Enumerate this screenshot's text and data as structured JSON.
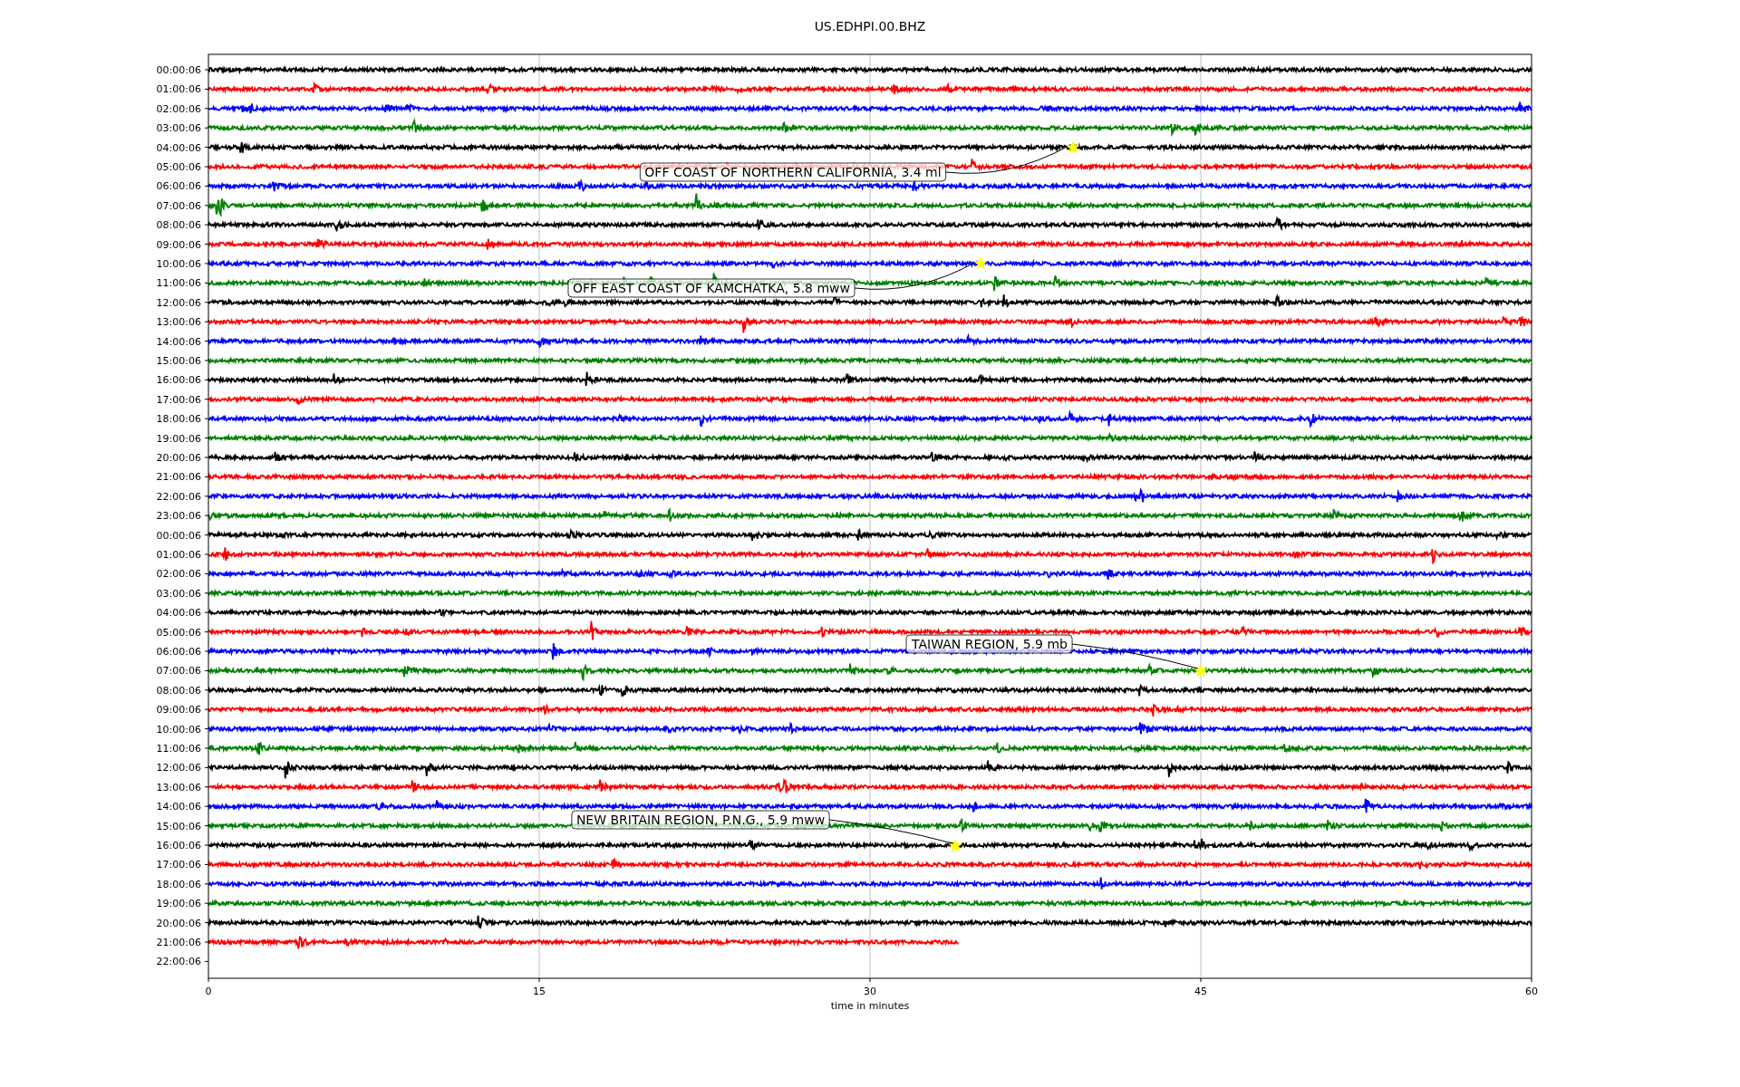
{
  "title": "US.EDHPI.00.BHZ",
  "rows": [
    {
      "label": "00:00:06",
      "color": "#000000",
      "kind": "full"
    },
    {
      "label": "01:00:06",
      "color": "#ff0000",
      "kind": "full"
    },
    {
      "label": "02:00:06",
      "color": "#0000ff",
      "kind": "full"
    },
    {
      "label": "03:00:06",
      "color": "#008000",
      "kind": "full"
    },
    {
      "label": "04:00:06",
      "color": "#000000",
      "kind": "full"
    },
    {
      "label": "05:00:06",
      "color": "#ff0000",
      "kind": "full"
    },
    {
      "label": "06:00:06",
      "color": "#0000ff",
      "kind": "full"
    },
    {
      "label": "07:00:06",
      "color": "#008000",
      "kind": "full"
    },
    {
      "label": "08:00:06",
      "color": "#000000",
      "kind": "full"
    },
    {
      "label": "09:00:06",
      "color": "#ff0000",
      "kind": "full"
    },
    {
      "label": "10:00:06",
      "color": "#0000ff",
      "kind": "full"
    },
    {
      "label": "11:00:06",
      "color": "#008000",
      "kind": "full"
    },
    {
      "label": "12:00:06",
      "color": "#000000",
      "kind": "full"
    },
    {
      "label": "13:00:06",
      "color": "#ff0000",
      "kind": "full"
    },
    {
      "label": "14:00:06",
      "color": "#0000ff",
      "kind": "full"
    },
    {
      "label": "15:00:06",
      "color": "#008000",
      "kind": "full"
    },
    {
      "label": "16:00:06",
      "color": "#000000",
      "kind": "full"
    },
    {
      "label": "17:00:06",
      "color": "#ff0000",
      "kind": "full"
    },
    {
      "label": "18:00:06",
      "color": "#0000ff",
      "kind": "full"
    },
    {
      "label": "19:00:06",
      "color": "#008000",
      "kind": "full"
    },
    {
      "label": "20:00:06",
      "color": "#000000",
      "kind": "full"
    },
    {
      "label": "21:00:06",
      "color": "#ff0000",
      "kind": "full"
    },
    {
      "label": "22:00:06",
      "color": "#0000ff",
      "kind": "full"
    },
    {
      "label": "23:00:06",
      "color": "#008000",
      "kind": "full"
    },
    {
      "label": "00:00:06",
      "color": "#000000",
      "kind": "full"
    },
    {
      "label": "01:00:06",
      "color": "#ff0000",
      "kind": "full"
    },
    {
      "label": "02:00:06",
      "color": "#0000ff",
      "kind": "full"
    },
    {
      "label": "03:00:06",
      "color": "#008000",
      "kind": "full"
    },
    {
      "label": "04:00:06",
      "color": "#000000",
      "kind": "full"
    },
    {
      "label": "05:00:06",
      "color": "#ff0000",
      "kind": "full"
    },
    {
      "label": "06:00:06",
      "color": "#0000ff",
      "kind": "full"
    },
    {
      "label": "07:00:06",
      "color": "#008000",
      "kind": "full"
    },
    {
      "label": "08:00:06",
      "color": "#000000",
      "kind": "full"
    },
    {
      "label": "09:00:06",
      "color": "#ff0000",
      "kind": "full"
    },
    {
      "label": "10:00:06",
      "color": "#0000ff",
      "kind": "full"
    },
    {
      "label": "11:00:06",
      "color": "#008000",
      "kind": "full"
    },
    {
      "label": "12:00:06",
      "color": "#000000",
      "kind": "full"
    },
    {
      "label": "13:00:06",
      "color": "#ff0000",
      "kind": "full"
    },
    {
      "label": "14:00:06",
      "color": "#0000ff",
      "kind": "full"
    },
    {
      "label": "15:00:06",
      "color": "#008000",
      "kind": "full"
    },
    {
      "label": "16:00:06",
      "color": "#000000",
      "kind": "full"
    },
    {
      "label": "17:00:06",
      "color": "#ff0000",
      "kind": "full"
    },
    {
      "label": "18:00:06",
      "color": "#0000ff",
      "kind": "full"
    },
    {
      "label": "19:00:06",
      "color": "#008000",
      "kind": "full"
    },
    {
      "label": "20:00:06",
      "color": "#000000",
      "kind": "full"
    },
    {
      "label": "21:00:06",
      "color": "#ff0000",
      "kind": "partial"
    },
    {
      "label": "22:00:06",
      "kind": "none"
    }
  ],
  "x_ticks": [
    "0",
    "15",
    "30",
    "45",
    "60"
  ],
  "x_label": "time in minutes",
  "events": [
    {
      "text": "OFF COAST OF NORTHERN CALIFORNIA, 3.4 ml"
    },
    {
      "text": "OFF EAST COAST OF KAMCHATKA, 5.8 mww"
    },
    {
      "text": "TAIWAN REGION, 5.9 mb"
    },
    {
      "text": "NEW BRITAIN REGION, P.N.G., 5.9 mww"
    }
  ]
}
